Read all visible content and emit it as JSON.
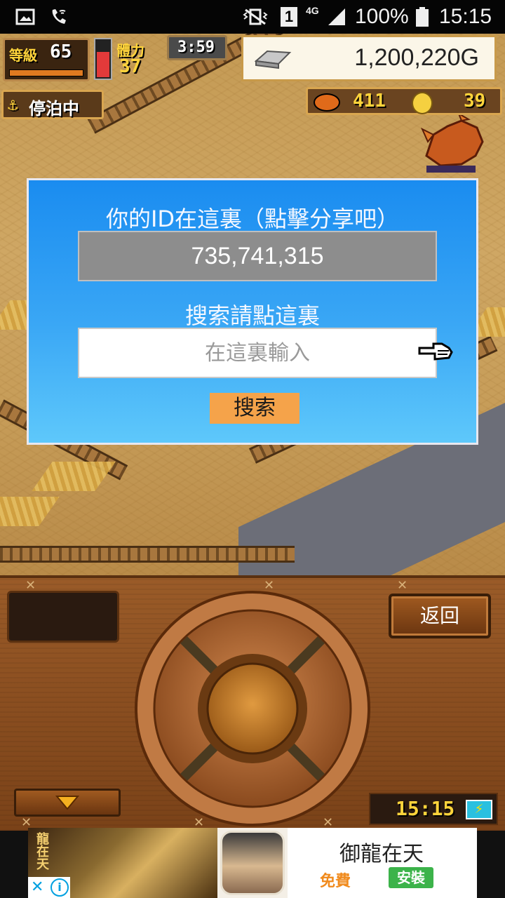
{
  "status_bar": {
    "battery": "100%",
    "time": "15:15",
    "network": "4G",
    "sim": "1",
    "icons": [
      "image-icon",
      "wifi-call-icon",
      "vibrate-icon",
      "sim-icon",
      "signal-icon",
      "battery-icon"
    ]
  },
  "hud": {
    "level_label": "等級",
    "level": "65",
    "stamina_label": "體力",
    "stamina": "37",
    "timer": "3:59",
    "gold": "1,200,220G",
    "docked_label": "停泊中",
    "fish_count": "411",
    "coin_count": "39"
  },
  "dialog": {
    "id_label": "你的ID在這裏（點擊分享吧）",
    "id_value": "735,741,315",
    "search_label": "搜索請點這裏",
    "search_placeholder": "在這裏輸入",
    "search_button": "搜索"
  },
  "panel": {
    "back_button": "返回",
    "clock": "15:15"
  },
  "ad": {
    "title": "御龍在天",
    "free_label": "免費",
    "install_label": "安裝",
    "logo_text": "龍在天"
  },
  "colors": {
    "dialog_top": "#1a8cf0",
    "dialog_bottom": "#5ec8fb",
    "search_button": "#f5a34a",
    "install_green": "#3cb34a",
    "free_orange": "#f08a1c"
  }
}
